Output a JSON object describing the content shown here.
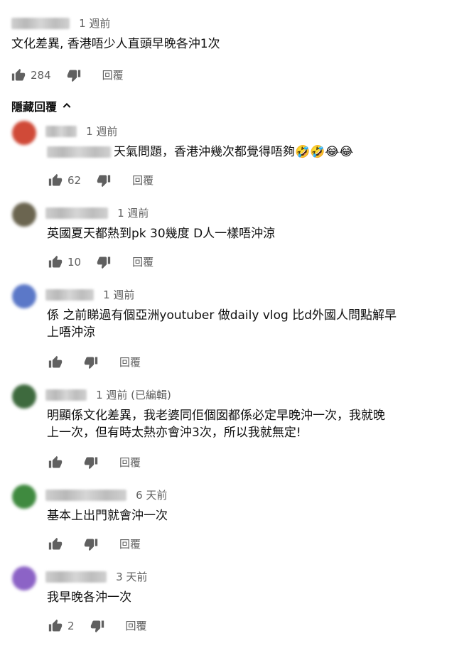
{
  "top_comment": {
    "time": "1 週前",
    "text": "文化差異, 香港唔少人直頭早晚各沖1次",
    "likes": "284",
    "reply_label": "回覆"
  },
  "hide_replies_label": "隱藏回覆",
  "replies": [
    {
      "time": "1 週前",
      "text": "天氣問題，香港沖幾次都覺得唔夠🤣🤣😂😂",
      "likes": "62",
      "reply_label": "回覆",
      "avatar_color": "#d04a38"
    },
    {
      "time": "1 週前",
      "text": "英國夏天都熱到pk 30幾度 D人一樣唔沖涼",
      "likes": "10",
      "reply_label": "回覆",
      "avatar_color": "#6b6550"
    },
    {
      "time": "1 週前",
      "text_line1": "係 之前睇過有個亞洲youtuber 做daily vlog 比d外國人問點解早",
      "text_line2": "上唔沖涼",
      "reply_label": "回覆",
      "avatar_color": "#5b78c8"
    },
    {
      "time": "1 週前 (已編輯)",
      "text_line1": "明顯係文化差異，我老婆同佢個囡都係必定早晚沖一次，我就晚",
      "text_line2": "上一次，但有時太熱亦會沖3次，所以我就無定!",
      "reply_label": "回覆",
      "avatar_color": "#3e6a3e"
    },
    {
      "time": "6 天前",
      "text": "基本上出門就會沖一次",
      "reply_label": "回覆",
      "avatar_color": "#3f8a3f"
    },
    {
      "time": "3 天前",
      "text": "我早晚各沖一次",
      "likes": "2",
      "reply_label": "回覆",
      "avatar_color": "#8c63c6"
    }
  ],
  "icons": {
    "like": "thumbs-up-icon",
    "dislike": "thumbs-down-icon",
    "hide": "chevron-up-icon"
  }
}
